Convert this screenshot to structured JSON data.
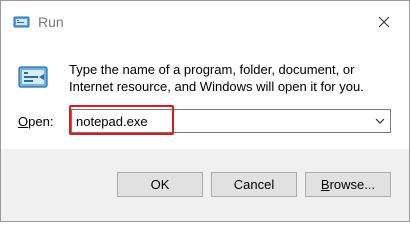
{
  "window": {
    "title": "Run"
  },
  "dialog": {
    "description": "Type the name of a program, folder, document, or Internet resource, and Windows will open it for you.",
    "open_label_prefix": "",
    "open_label_underlined": "O",
    "open_label_rest": "pen:",
    "open_value": "notepad.exe"
  },
  "buttons": {
    "ok": "OK",
    "cancel": "Cancel",
    "browse_underlined": "B",
    "browse_rest": "rowse..."
  },
  "colors": {
    "highlight": "#e0191c",
    "footer_bg": "#f0f0f0",
    "button_bg": "#e1e1e1"
  },
  "icons": {
    "title": "run-app-icon",
    "close": "close-icon",
    "app": "run-app-icon",
    "dropdown": "chevron-down-icon"
  }
}
